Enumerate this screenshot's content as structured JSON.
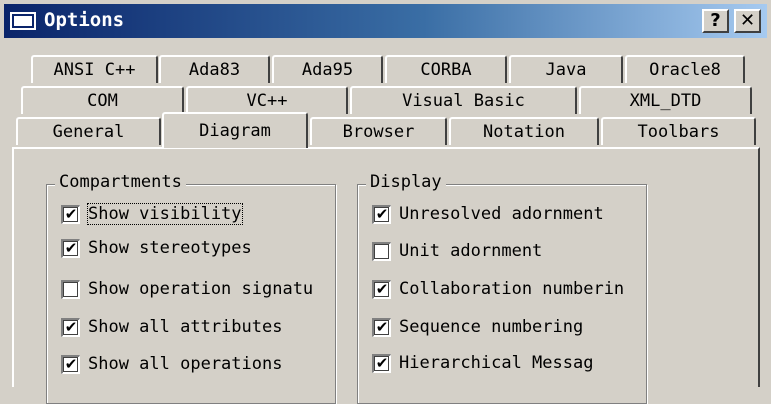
{
  "window": {
    "title": "Options"
  },
  "titlebar_buttons": {
    "help": "?",
    "close": "✕"
  },
  "tabs": {
    "row1": [
      "ANSI C++",
      "Ada83",
      "Ada95",
      "CORBA",
      "Java",
      "Oracle8"
    ],
    "row2": [
      "COM",
      "VC++",
      "Visual Basic",
      "XML_DTD"
    ],
    "row3": [
      "General",
      "Diagram",
      "Browser",
      "Notation",
      "Toolbars"
    ],
    "active": "Diagram"
  },
  "compartments": {
    "legend": "Compartments",
    "items": [
      {
        "label": "Show visibility",
        "checked": true
      },
      {
        "label": "Show stereotypes",
        "checked": true
      },
      {
        "label": "Show operation signatu",
        "checked": false
      },
      {
        "label": "Show all attributes",
        "checked": true
      },
      {
        "label": "Show all operations",
        "checked": true
      }
    ]
  },
  "display": {
    "legend": "Display",
    "items": [
      {
        "label": "Unresolved adornment",
        "checked": true
      },
      {
        "label": "Unit adornment",
        "checked": false
      },
      {
        "label": "Collaboration numberin",
        "checked": true
      },
      {
        "label": "Sequence numbering",
        "checked": true
      },
      {
        "label": "Hierarchical Messag",
        "checked": true
      }
    ]
  },
  "check_glyph": "✔"
}
